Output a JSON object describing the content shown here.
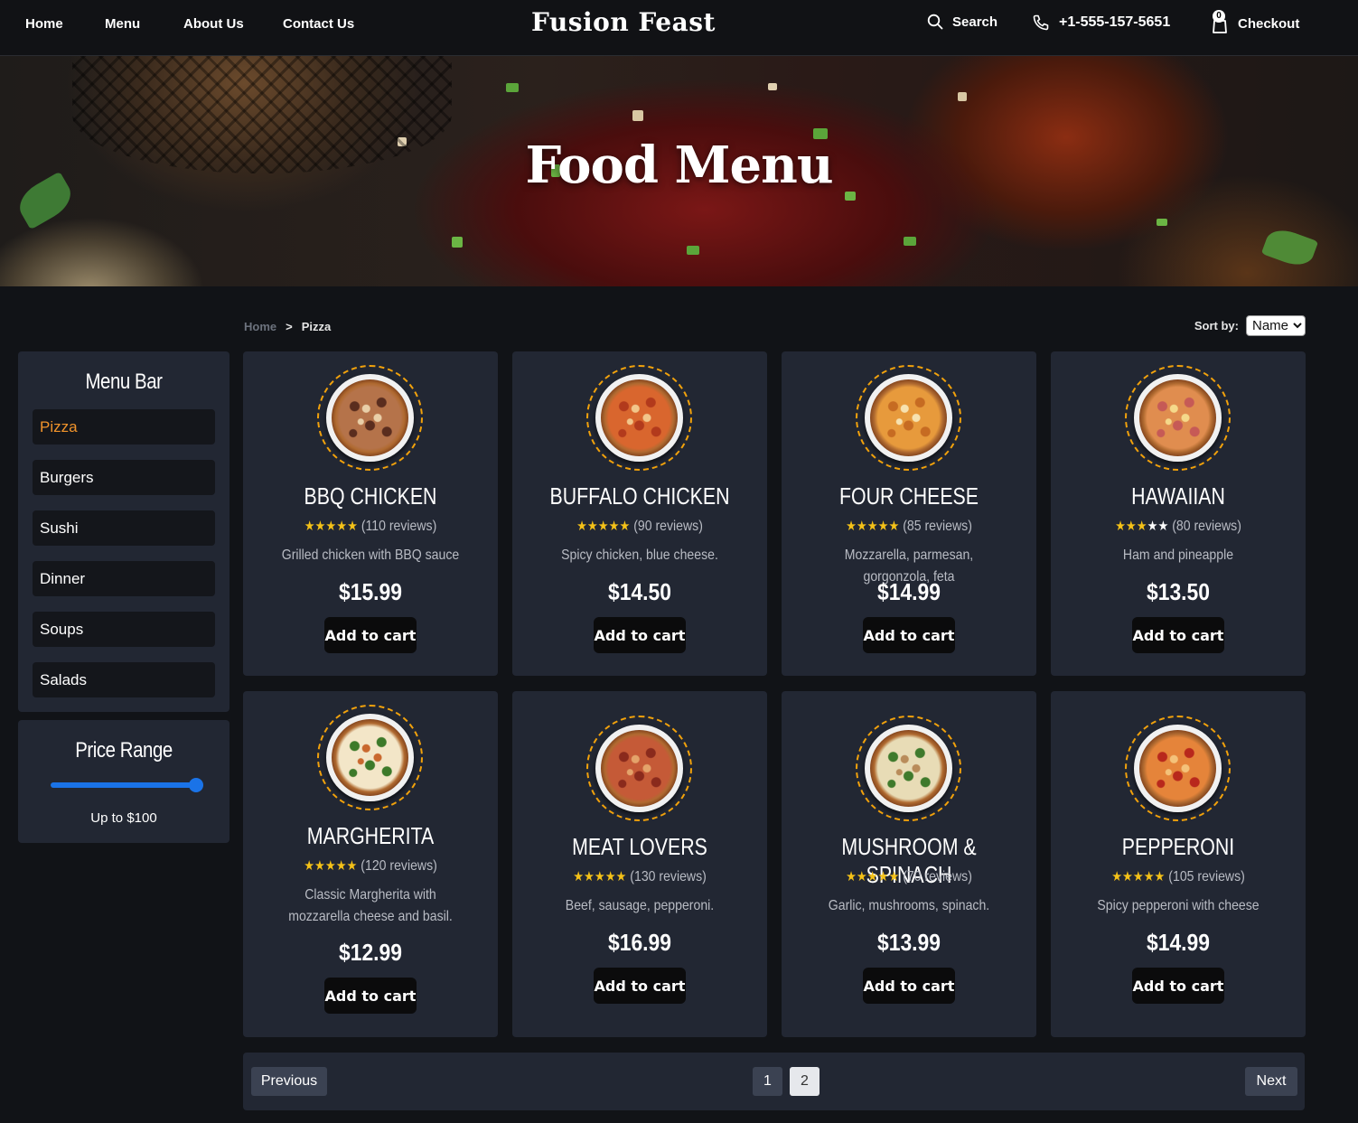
{
  "nav": {
    "home": "Home",
    "menu": "Menu",
    "about": "About Us",
    "contact": "Contact Us",
    "brand": "Fusion Feast",
    "search": "Search",
    "phone": "+1-555-157-5651",
    "cart_count": "0",
    "checkout": "Checkout"
  },
  "hero": {
    "title": "Food Menu"
  },
  "breadcrumb": {
    "home": "Home",
    "separator": ">",
    "current": "Pizza"
  },
  "sort": {
    "label": "Sort by:",
    "selected": "Name"
  },
  "sidebar": {
    "title": "Menu Bar",
    "items": [
      "Pizza",
      "Burgers",
      "Sushi",
      "Dinner",
      "Soups",
      "Salads"
    ],
    "active": "Pizza"
  },
  "price_range": {
    "title": "Price Range",
    "label": "Up to $100",
    "value_fraction": 1.0
  },
  "products": [
    {
      "name": "BBQ CHICKEN",
      "rating": 5,
      "reviews": "(110 reviews)",
      "desc": "Grilled chicken with BBQ sauce",
      "price": "$15.99",
      "button": "Add to cart",
      "colors": [
        "#b5734a",
        "#5a2d1e",
        "#e9cfa8"
      ]
    },
    {
      "name": "BUFFALO CHICKEN",
      "rating": 5,
      "reviews": "(90 reviews)",
      "desc": "Spicy chicken, blue cheese.",
      "price": "$14.50",
      "button": "Add to cart",
      "colors": [
        "#d9662e",
        "#b23a1c",
        "#f2c68a"
      ]
    },
    {
      "name": "FOUR CHEESE",
      "rating": 5,
      "reviews": "(85 reviews)",
      "desc": "Mozzarella, parmesan, gorgonzola, feta",
      "price": "$14.99",
      "button": "Add to cart",
      "colors": [
        "#e79a3c",
        "#c66b22",
        "#f7e2b0"
      ]
    },
    {
      "name": "HAWAIIAN",
      "rating": 3,
      "reviews": "(80 reviews)",
      "desc": "Ham and pineapple",
      "price": "$13.50",
      "button": "Add to cart",
      "colors": [
        "#e08d4f",
        "#c65a56",
        "#f5d98a"
      ]
    },
    {
      "name": "MARGHERITA",
      "rating": 5,
      "reviews": "(120 reviews)",
      "desc": "Classic Margherita with mozzarella cheese and basil.",
      "price": "$12.99",
      "button": "Add to cart",
      "colors": [
        "#f3e6c8",
        "#3d7a2a",
        "#c9682e"
      ]
    },
    {
      "name": "MEAT LOVERS",
      "rating": 5,
      "reviews": "(130 reviews)",
      "desc": "Beef, sausage, pepperoni.",
      "price": "$16.99",
      "button": "Add to cart",
      "colors": [
        "#c55a37",
        "#8a2a1c",
        "#e4a36a"
      ]
    },
    {
      "name": "MUSHROOM & SPINACH",
      "rating": 5,
      "reviews": "(70 reviews)",
      "desc": "Garlic, mushrooms, spinach.",
      "price": "$13.99",
      "button": "Add to cart",
      "colors": [
        "#e8dcb6",
        "#3f7a2c",
        "#b98c5a"
      ]
    },
    {
      "name": "PEPPERONI",
      "rating": 5,
      "reviews": "(105 reviews)",
      "desc": "Spicy pepperoni with cheese",
      "price": "$14.99",
      "button": "Add to cart",
      "colors": [
        "#e5843a",
        "#b8281c",
        "#f4c27a"
      ]
    }
  ],
  "pagination": {
    "previous": "Previous",
    "pages": [
      "1",
      "2"
    ],
    "current": "2",
    "next": "Next"
  },
  "colors": {
    "accent": "#f0932b",
    "star": "#f5c218",
    "slider": "#1a73e8",
    "card_bg": "#222733"
  }
}
